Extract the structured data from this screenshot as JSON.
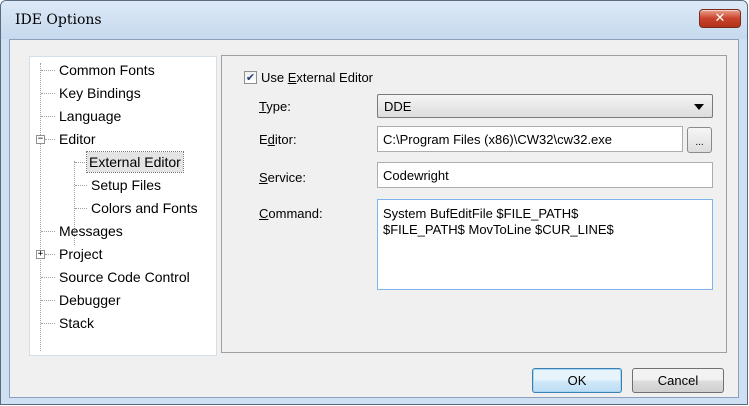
{
  "window": {
    "title": "IDE Options",
    "close_glyph": "✕"
  },
  "tree": {
    "items": [
      {
        "label": "Common Fonts"
      },
      {
        "label": "Key Bindings"
      },
      {
        "label": "Language"
      },
      {
        "label": "Editor",
        "expander": "−"
      },
      {
        "label": "External Editor"
      },
      {
        "label": "Setup Files"
      },
      {
        "label": "Colors and Fonts"
      },
      {
        "label": "Messages"
      },
      {
        "label": "Project",
        "expander": "+"
      },
      {
        "label": "Source Code Control"
      },
      {
        "label": "Debugger"
      },
      {
        "label": "Stack"
      }
    ],
    "selected": "External Editor"
  },
  "external_editor": {
    "use_external": {
      "label_pre": "Use ",
      "label_ul": "E",
      "label_post": "xternal Editor",
      "checked": true,
      "check_glyph": "✔"
    },
    "type": {
      "label_ul": "T",
      "label_post": "ype:",
      "value": "DDE"
    },
    "editor": {
      "label_pre": "E",
      "label_ul": "d",
      "label_post": "itor:",
      "value": "C:\\Program Files (x86)\\CW32\\cw32.exe",
      "browse_label": "..."
    },
    "service": {
      "label_ul": "S",
      "label_post": "ervice:",
      "value": "Codewright"
    },
    "command": {
      "label_ul": "C",
      "label_post": "ommand:",
      "value": "System BufEditFile $FILE_PATH$\n$FILE_PATH$ MovToLine $CUR_LINE$"
    }
  },
  "buttons": {
    "ok": "OK",
    "cancel": "Cancel"
  }
}
